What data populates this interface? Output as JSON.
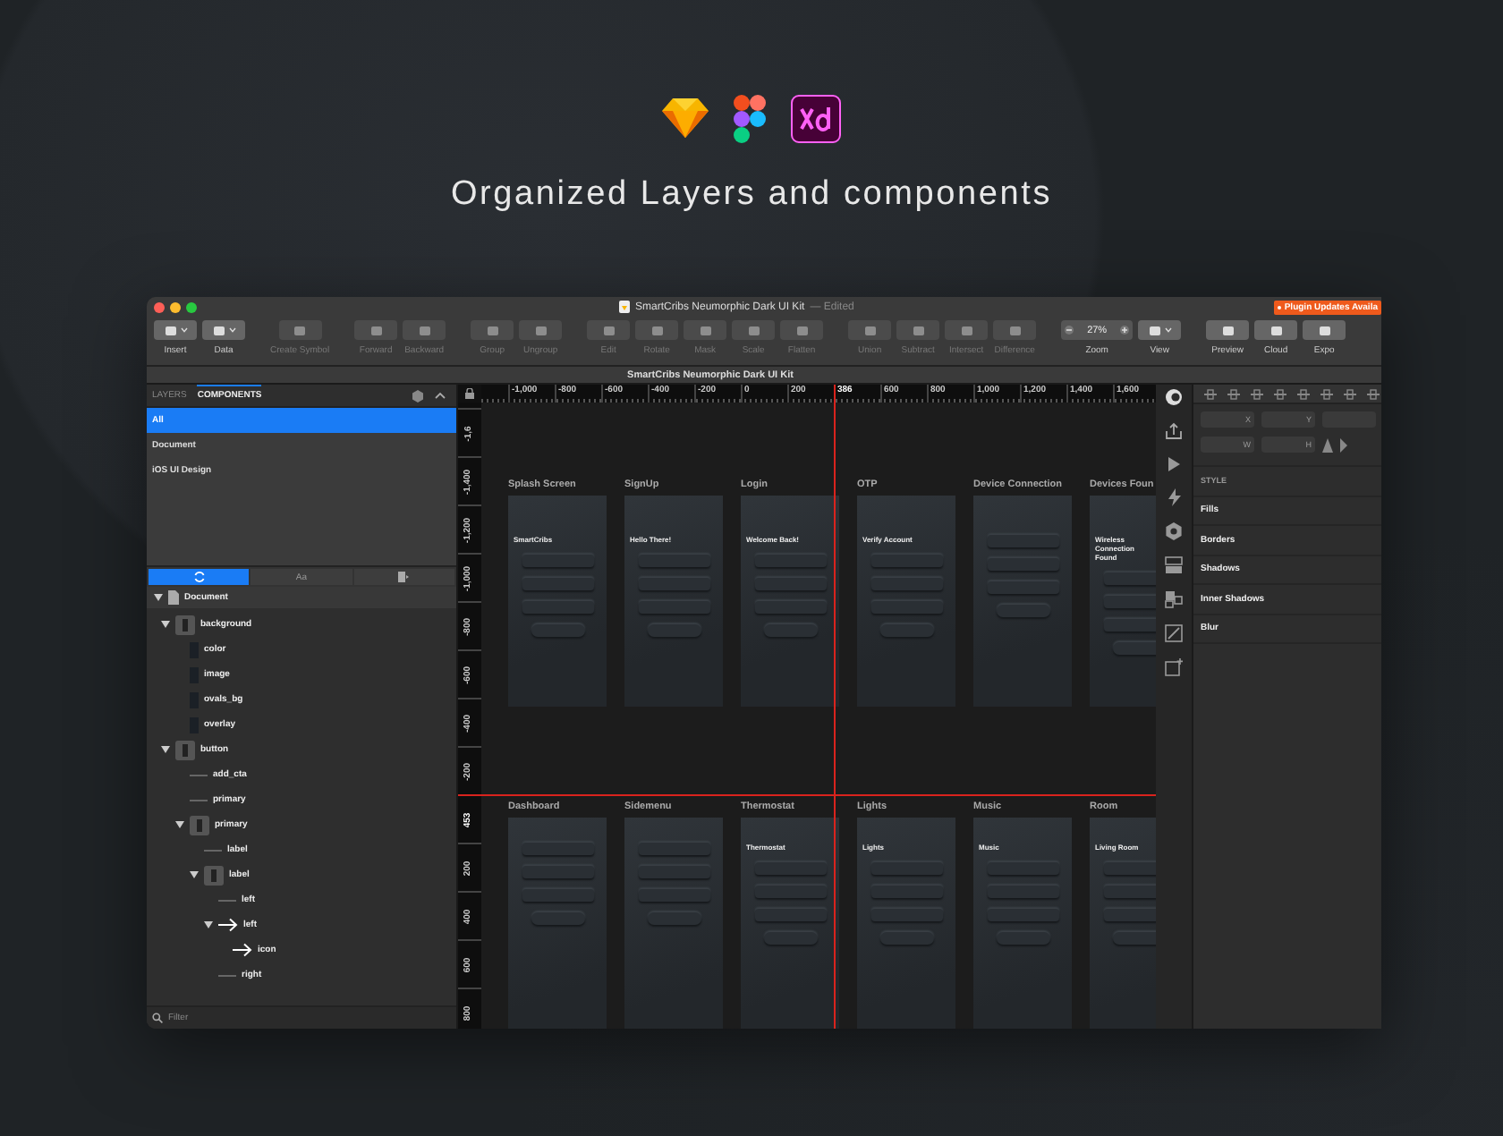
{
  "page": {
    "title": "Organized Layers and components"
  },
  "window": {
    "title": "SmartCribs Neumorphic Dark UI Kit",
    "status": "— Edited",
    "notice": "Plugin Updates Availa",
    "document_title": "SmartCribs Neumorphic Dark UI Kit"
  },
  "toolbar": {
    "groups": [
      {
        "items": [
          {
            "label": "Insert",
            "kind": "menu",
            "disabled": false
          },
          {
            "label": "Data",
            "kind": "menu",
            "disabled": false
          }
        ]
      },
      {
        "items": [
          {
            "label": "Create Symbol",
            "kind": "button",
            "disabled": true
          }
        ]
      },
      {
        "items": [
          {
            "label": "Forward",
            "kind": "button",
            "disabled": true
          },
          {
            "label": "Backward",
            "kind": "button",
            "disabled": true
          }
        ]
      },
      {
        "items": [
          {
            "label": "Group",
            "kind": "button",
            "disabled": true
          },
          {
            "label": "Ungroup",
            "kind": "button",
            "disabled": true
          }
        ]
      },
      {
        "items": [
          {
            "label": "Edit",
            "kind": "button",
            "disabled": true
          },
          {
            "label": "Rotate",
            "kind": "button",
            "disabled": true
          },
          {
            "label": "Mask",
            "kind": "button",
            "disabled": true
          },
          {
            "label": "Scale",
            "kind": "button",
            "disabled": true
          },
          {
            "label": "Flatten",
            "kind": "button",
            "disabled": true
          }
        ]
      },
      {
        "items": [
          {
            "label": "Union",
            "kind": "button",
            "disabled": true
          },
          {
            "label": "Subtract",
            "kind": "button",
            "disabled": true
          },
          {
            "label": "Intersect",
            "kind": "button",
            "disabled": true
          },
          {
            "label": "Difference",
            "kind": "button",
            "disabled": true
          }
        ]
      },
      {
        "items": [
          {
            "label": "Zoom",
            "kind": "zoom",
            "value": "27%",
            "disabled": false
          },
          {
            "label": "View",
            "kind": "menu",
            "disabled": false
          }
        ]
      },
      {
        "items": [
          {
            "label": "Preview",
            "kind": "button",
            "disabled": false
          },
          {
            "label": "Cloud",
            "kind": "button",
            "disabled": false
          },
          {
            "label": "Expo",
            "kind": "button",
            "disabled": false
          }
        ]
      }
    ]
  },
  "left_panel": {
    "tabs": [
      {
        "label": "LAYERS",
        "selected": false
      },
      {
        "label": "COMPONENTS",
        "selected": true
      }
    ],
    "libraries": [
      {
        "label": "All",
        "selected": true
      },
      {
        "label": "Document",
        "selected": false
      },
      {
        "label": "iOS UI Design",
        "selected": false
      }
    ],
    "segments": [
      {
        "kind": "symbols",
        "selected": true
      },
      {
        "kind": "text",
        "label": "Aa",
        "selected": false
      },
      {
        "kind": "styles",
        "selected": false
      }
    ],
    "tree": {
      "name": "Document",
      "kind": "page",
      "expanded": true,
      "children": [
        {
          "name": "background",
          "kind": "group",
          "expanded": true,
          "children": [
            {
              "name": "color",
              "kind": "shape"
            },
            {
              "name": "image",
              "kind": "shape"
            },
            {
              "name": "ovals_bg",
              "kind": "shape"
            },
            {
              "name": "overlay",
              "kind": "shape"
            }
          ]
        },
        {
          "name": "button",
          "kind": "group",
          "expanded": true,
          "children": [
            {
              "name": "add_cta",
              "kind": "line"
            },
            {
              "name": "primary",
              "kind": "line"
            },
            {
              "name": "primary",
              "kind": "group",
              "expanded": true,
              "children": [
                {
                  "name": "label",
                  "kind": "line"
                },
                {
                  "name": "label",
                  "kind": "group",
                  "expanded": true,
                  "children": [
                    {
                      "name": "left",
                      "kind": "line"
                    },
                    {
                      "name": "left",
                      "kind": "arrow",
                      "expanded": true,
                      "children": [
                        {
                          "name": "icon",
                          "kind": "arrow"
                        }
                      ]
                    },
                    {
                      "name": "right",
                      "kind": "line"
                    }
                  ]
                }
              ]
            }
          ]
        }
      ]
    },
    "filter": {
      "placeholder": "Filter"
    }
  },
  "canvas": {
    "ruler_x": [
      {
        "label": "-1,000",
        "guide": false
      },
      {
        "label": "-800",
        "guide": false
      },
      {
        "label": "-600",
        "guide": false
      },
      {
        "label": "-400",
        "guide": false
      },
      {
        "label": "-200",
        "guide": false
      },
      {
        "label": "0",
        "guide": false
      },
      {
        "label": "200",
        "guide": false
      },
      {
        "label": "386",
        "guide": true
      },
      {
        "label": "600",
        "guide": false
      },
      {
        "label": "800",
        "guide": false
      },
      {
        "label": "1,000",
        "guide": false
      },
      {
        "label": "1,200",
        "guide": false
      },
      {
        "label": "1,400",
        "guide": false
      },
      {
        "label": "1,600",
        "guide": false
      }
    ],
    "ruler_y": [
      {
        "label": "-1,6",
        "guide": false
      },
      {
        "label": "-1,400",
        "guide": false
      },
      {
        "label": "-1,200",
        "guide": false
      },
      {
        "label": "-1,000",
        "guide": false
      },
      {
        "label": "-800",
        "guide": false
      },
      {
        "label": "-600",
        "guide": false
      },
      {
        "label": "-400",
        "guide": false
      },
      {
        "label": "-200",
        "guide": false
      },
      {
        "label": "453",
        "guide": true
      },
      {
        "label": "200",
        "guide": false
      },
      {
        "label": "400",
        "guide": false
      },
      {
        "label": "600",
        "guide": false
      },
      {
        "label": "800",
        "guide": false
      }
    ],
    "rows": [
      {
        "artboards": [
          {
            "title": "Splash Screen",
            "heading": "SmartCribs"
          },
          {
            "title": "SignUp",
            "heading": "Hello There!"
          },
          {
            "title": "Login",
            "heading": "Welcome Back!"
          },
          {
            "title": "OTP",
            "heading": "Verify Account"
          },
          {
            "title": "Device Connection"
          },
          {
            "title": "Devices Foun",
            "heading": "Wireless Connection Found"
          }
        ]
      },
      {
        "artboards": [
          {
            "title": "Dashboard"
          },
          {
            "title": "Sidemenu"
          },
          {
            "title": "Thermostat",
            "heading": "Thermostat"
          },
          {
            "title": "Lights",
            "heading": "Lights"
          },
          {
            "title": "Music",
            "heading": "Music"
          },
          {
            "title": "Room",
            "heading": "Living Room"
          }
        ]
      }
    ]
  },
  "inspector": {
    "fields": [
      [
        "X",
        "Y"
      ],
      [
        "W",
        "H"
      ]
    ],
    "sections": [
      {
        "label": "STYLE",
        "kind": "header"
      },
      {
        "label": "Fills",
        "kind": "section"
      },
      {
        "label": "Borders",
        "kind": "section"
      },
      {
        "label": "Shadows",
        "kind": "section"
      },
      {
        "label": "Inner Shadows",
        "kind": "section"
      },
      {
        "label": "Blur",
        "kind": "section"
      }
    ]
  }
}
